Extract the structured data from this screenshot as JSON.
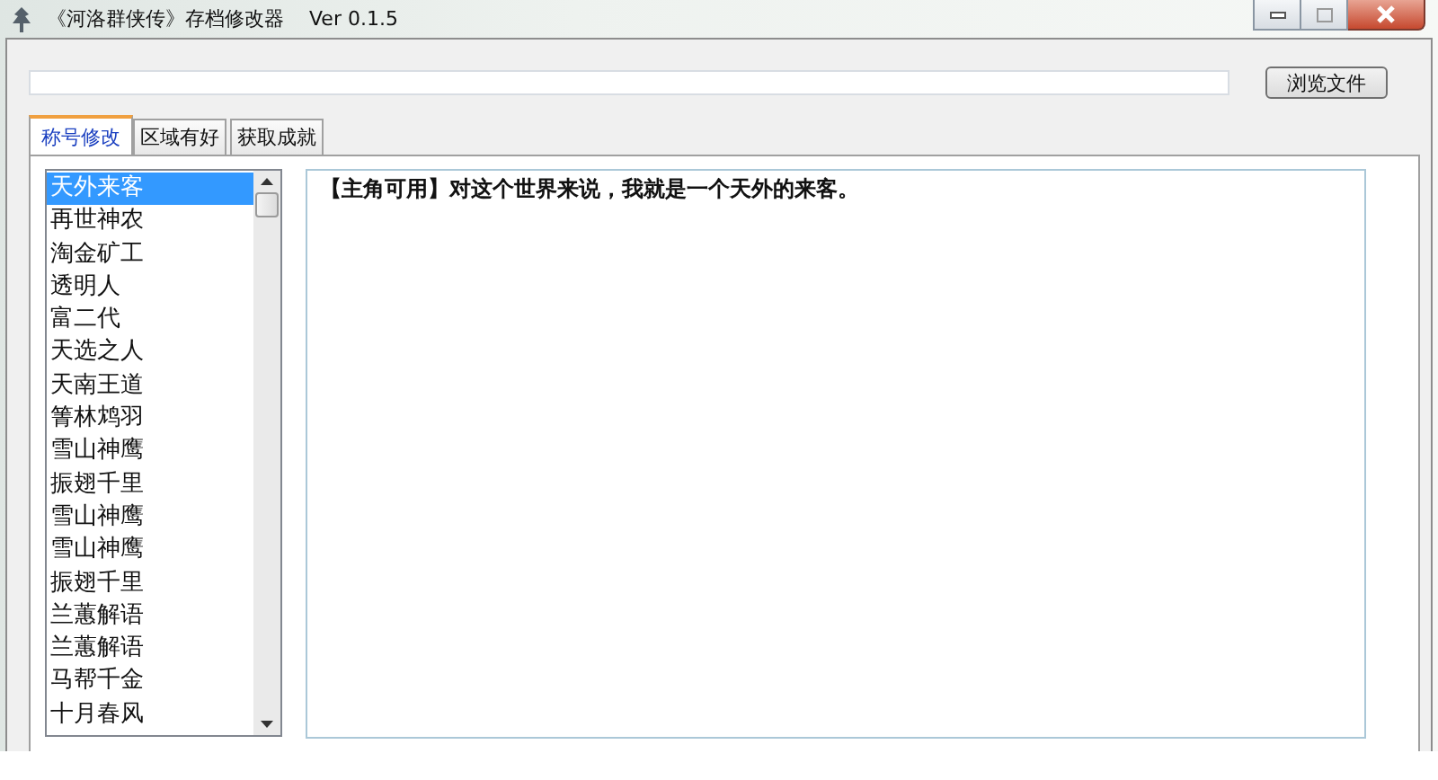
{
  "window": {
    "title": "《河洛群侠传》存档修改器",
    "version": "Ver 0.1.5"
  },
  "browse_button": "浏览文件",
  "tabs": [
    {
      "label": "称号修改",
      "selected": true
    },
    {
      "label": "区域有好",
      "selected": false
    },
    {
      "label": "获取成就",
      "selected": false
    }
  ],
  "title_list": [
    {
      "label": "天外来客",
      "selected": true
    },
    {
      "label": "再世神农",
      "selected": false
    },
    {
      "label": "淘金矿工",
      "selected": false
    },
    {
      "label": "透明人",
      "selected": false
    },
    {
      "label": "富二代",
      "selected": false
    },
    {
      "label": "天选之人",
      "selected": false
    },
    {
      "label": "天南王道",
      "selected": false
    },
    {
      "label": "箐林鸩羽",
      "selected": false
    },
    {
      "label": "雪山神鹰",
      "selected": false
    },
    {
      "label": "振翅千里",
      "selected": false
    },
    {
      "label": "雪山神鹰",
      "selected": false
    },
    {
      "label": "雪山神鹰",
      "selected": false
    },
    {
      "label": "振翅千里",
      "selected": false
    },
    {
      "label": "兰蕙解语",
      "selected": false
    },
    {
      "label": "兰蕙解语",
      "selected": false
    },
    {
      "label": "马帮千金",
      "selected": false
    },
    {
      "label": "十月春风",
      "selected": false
    }
  ],
  "description": "【主角可用】对这个世界来说，我就是一个天外的来客。"
}
